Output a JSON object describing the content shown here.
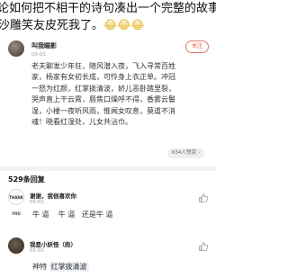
{
  "title": {
    "line1": "论如何把不相干的诗句凑出一个完整的故事",
    "line2_text": "沙雕笑友皮死我了。",
    "line2_emoji": "😂😂😂"
  },
  "post": {
    "username": "叫我瞄影",
    "date": "05-01",
    "follow_label": "关注",
    "poem_lines": [
      "老夫聊发少年狂，随风潜入夜，飞入寻常百姓",
      "家，杨家有女初长成，可怜身上衣正单。冲冠",
      "一怒为红颜，红掌拨清波，娇儿恶卧踏里裂，",
      "哭声直上干云霄，唇焦口燥呼不得，香雾云鬟",
      "湿，小楼一夜听风雨，惟闻女叹息，莫道不消",
      "魂！晓看红湿处，儿女共沾巾。"
    ],
    "likes": "634人赞赏",
    "likes_chevron": "›"
  },
  "replies": {
    "count_label": "529条回复",
    "items": [
      {
        "username": "谢谢，我很喜欢你",
        "date": "05-01",
        "avatar_text": "THANK YOU",
        "text": "牛 逼    牛 逼   还是牛 逼"
      },
      {
        "username": "我是小妖怪（段）",
        "date": "05-01",
        "text_prefix": "神特 ",
        "text_quote": "红掌拨清波"
      }
    ]
  },
  "icons": {
    "thumb": "thumbs-up-icon"
  }
}
